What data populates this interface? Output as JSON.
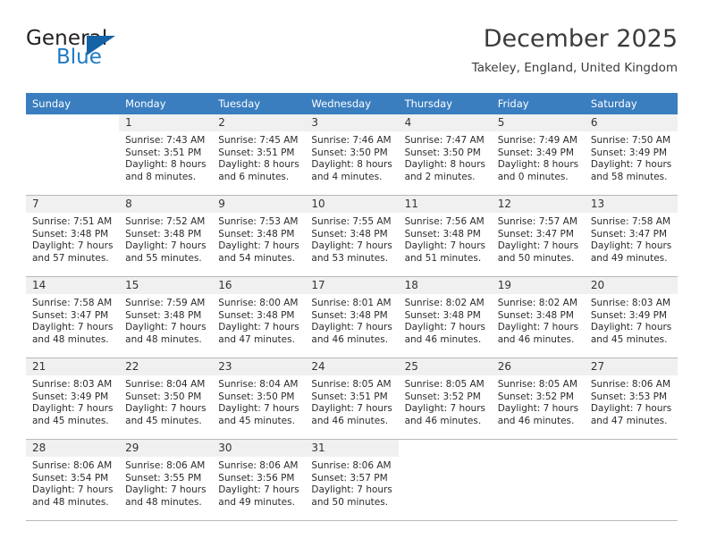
{
  "brand": {
    "word_one": "General",
    "word_two": "Blue",
    "triangle_color": "#1464a5",
    "blue_text_color": "#1e7bc4"
  },
  "header": {
    "title": "December 2025",
    "location": "Takeley, England, United Kingdom"
  },
  "colors": {
    "header_row": "#3a7ebf",
    "day_number_bar": "#f0f0f0",
    "grid_line": "#b9b9b9",
    "text": "#2b2b2b"
  },
  "weekday_headers": [
    "Sunday",
    "Monday",
    "Tuesday",
    "Wednesday",
    "Thursday",
    "Friday",
    "Saturday"
  ],
  "weeks": [
    [
      {
        "day": "",
        "blank": true,
        "lines": []
      },
      {
        "day": "1",
        "lines": [
          "Sunrise: 7:43 AM",
          "Sunset: 3:51 PM",
          "Daylight: 8 hours",
          "and 8 minutes."
        ]
      },
      {
        "day": "2",
        "lines": [
          "Sunrise: 7:45 AM",
          "Sunset: 3:51 PM",
          "Daylight: 8 hours",
          "and 6 minutes."
        ]
      },
      {
        "day": "3",
        "lines": [
          "Sunrise: 7:46 AM",
          "Sunset: 3:50 PM",
          "Daylight: 8 hours",
          "and 4 minutes."
        ]
      },
      {
        "day": "4",
        "lines": [
          "Sunrise: 7:47 AM",
          "Sunset: 3:50 PM",
          "Daylight: 8 hours",
          "and 2 minutes."
        ]
      },
      {
        "day": "5",
        "lines": [
          "Sunrise: 7:49 AM",
          "Sunset: 3:49 PM",
          "Daylight: 8 hours",
          "and 0 minutes."
        ]
      },
      {
        "day": "6",
        "lines": [
          "Sunrise: 7:50 AM",
          "Sunset: 3:49 PM",
          "Daylight: 7 hours",
          "and 58 minutes."
        ]
      }
    ],
    [
      {
        "day": "7",
        "lines": [
          "Sunrise: 7:51 AM",
          "Sunset: 3:48 PM",
          "Daylight: 7 hours",
          "and 57 minutes."
        ]
      },
      {
        "day": "8",
        "lines": [
          "Sunrise: 7:52 AM",
          "Sunset: 3:48 PM",
          "Daylight: 7 hours",
          "and 55 minutes."
        ]
      },
      {
        "day": "9",
        "lines": [
          "Sunrise: 7:53 AM",
          "Sunset: 3:48 PM",
          "Daylight: 7 hours",
          "and 54 minutes."
        ]
      },
      {
        "day": "10",
        "lines": [
          "Sunrise: 7:55 AM",
          "Sunset: 3:48 PM",
          "Daylight: 7 hours",
          "and 53 minutes."
        ]
      },
      {
        "day": "11",
        "lines": [
          "Sunrise: 7:56 AM",
          "Sunset: 3:48 PM",
          "Daylight: 7 hours",
          "and 51 minutes."
        ]
      },
      {
        "day": "12",
        "lines": [
          "Sunrise: 7:57 AM",
          "Sunset: 3:47 PM",
          "Daylight: 7 hours",
          "and 50 minutes."
        ]
      },
      {
        "day": "13",
        "lines": [
          "Sunrise: 7:58 AM",
          "Sunset: 3:47 PM",
          "Daylight: 7 hours",
          "and 49 minutes."
        ]
      }
    ],
    [
      {
        "day": "14",
        "lines": [
          "Sunrise: 7:58 AM",
          "Sunset: 3:47 PM",
          "Daylight: 7 hours",
          "and 48 minutes."
        ]
      },
      {
        "day": "15",
        "lines": [
          "Sunrise: 7:59 AM",
          "Sunset: 3:48 PM",
          "Daylight: 7 hours",
          "and 48 minutes."
        ]
      },
      {
        "day": "16",
        "lines": [
          "Sunrise: 8:00 AM",
          "Sunset: 3:48 PM",
          "Daylight: 7 hours",
          "and 47 minutes."
        ]
      },
      {
        "day": "17",
        "lines": [
          "Sunrise: 8:01 AM",
          "Sunset: 3:48 PM",
          "Daylight: 7 hours",
          "and 46 minutes."
        ]
      },
      {
        "day": "18",
        "lines": [
          "Sunrise: 8:02 AM",
          "Sunset: 3:48 PM",
          "Daylight: 7 hours",
          "and 46 minutes."
        ]
      },
      {
        "day": "19",
        "lines": [
          "Sunrise: 8:02 AM",
          "Sunset: 3:48 PM",
          "Daylight: 7 hours",
          "and 46 minutes."
        ]
      },
      {
        "day": "20",
        "lines": [
          "Sunrise: 8:03 AM",
          "Sunset: 3:49 PM",
          "Daylight: 7 hours",
          "and 45 minutes."
        ]
      }
    ],
    [
      {
        "day": "21",
        "lines": [
          "Sunrise: 8:03 AM",
          "Sunset: 3:49 PM",
          "Daylight: 7 hours",
          "and 45 minutes."
        ]
      },
      {
        "day": "22",
        "lines": [
          "Sunrise: 8:04 AM",
          "Sunset: 3:50 PM",
          "Daylight: 7 hours",
          "and 45 minutes."
        ]
      },
      {
        "day": "23",
        "lines": [
          "Sunrise: 8:04 AM",
          "Sunset: 3:50 PM",
          "Daylight: 7 hours",
          "and 45 minutes."
        ]
      },
      {
        "day": "24",
        "lines": [
          "Sunrise: 8:05 AM",
          "Sunset: 3:51 PM",
          "Daylight: 7 hours",
          "and 46 minutes."
        ]
      },
      {
        "day": "25",
        "lines": [
          "Sunrise: 8:05 AM",
          "Sunset: 3:52 PM",
          "Daylight: 7 hours",
          "and 46 minutes."
        ]
      },
      {
        "day": "26",
        "lines": [
          "Sunrise: 8:05 AM",
          "Sunset: 3:52 PM",
          "Daylight: 7 hours",
          "and 46 minutes."
        ]
      },
      {
        "day": "27",
        "lines": [
          "Sunrise: 8:06 AM",
          "Sunset: 3:53 PM",
          "Daylight: 7 hours",
          "and 47 minutes."
        ]
      }
    ],
    [
      {
        "day": "28",
        "lines": [
          "Sunrise: 8:06 AM",
          "Sunset: 3:54 PM",
          "Daylight: 7 hours",
          "and 48 minutes."
        ]
      },
      {
        "day": "29",
        "lines": [
          "Sunrise: 8:06 AM",
          "Sunset: 3:55 PM",
          "Daylight: 7 hours",
          "and 48 minutes."
        ]
      },
      {
        "day": "30",
        "lines": [
          "Sunrise: 8:06 AM",
          "Sunset: 3:56 PM",
          "Daylight: 7 hours",
          "and 49 minutes."
        ]
      },
      {
        "day": "31",
        "lines": [
          "Sunrise: 8:06 AM",
          "Sunset: 3:57 PM",
          "Daylight: 7 hours",
          "and 50 minutes."
        ]
      },
      {
        "day": "",
        "blank": true,
        "lines": []
      },
      {
        "day": "",
        "blank": true,
        "lines": []
      },
      {
        "day": "",
        "blank": true,
        "lines": []
      }
    ]
  ]
}
